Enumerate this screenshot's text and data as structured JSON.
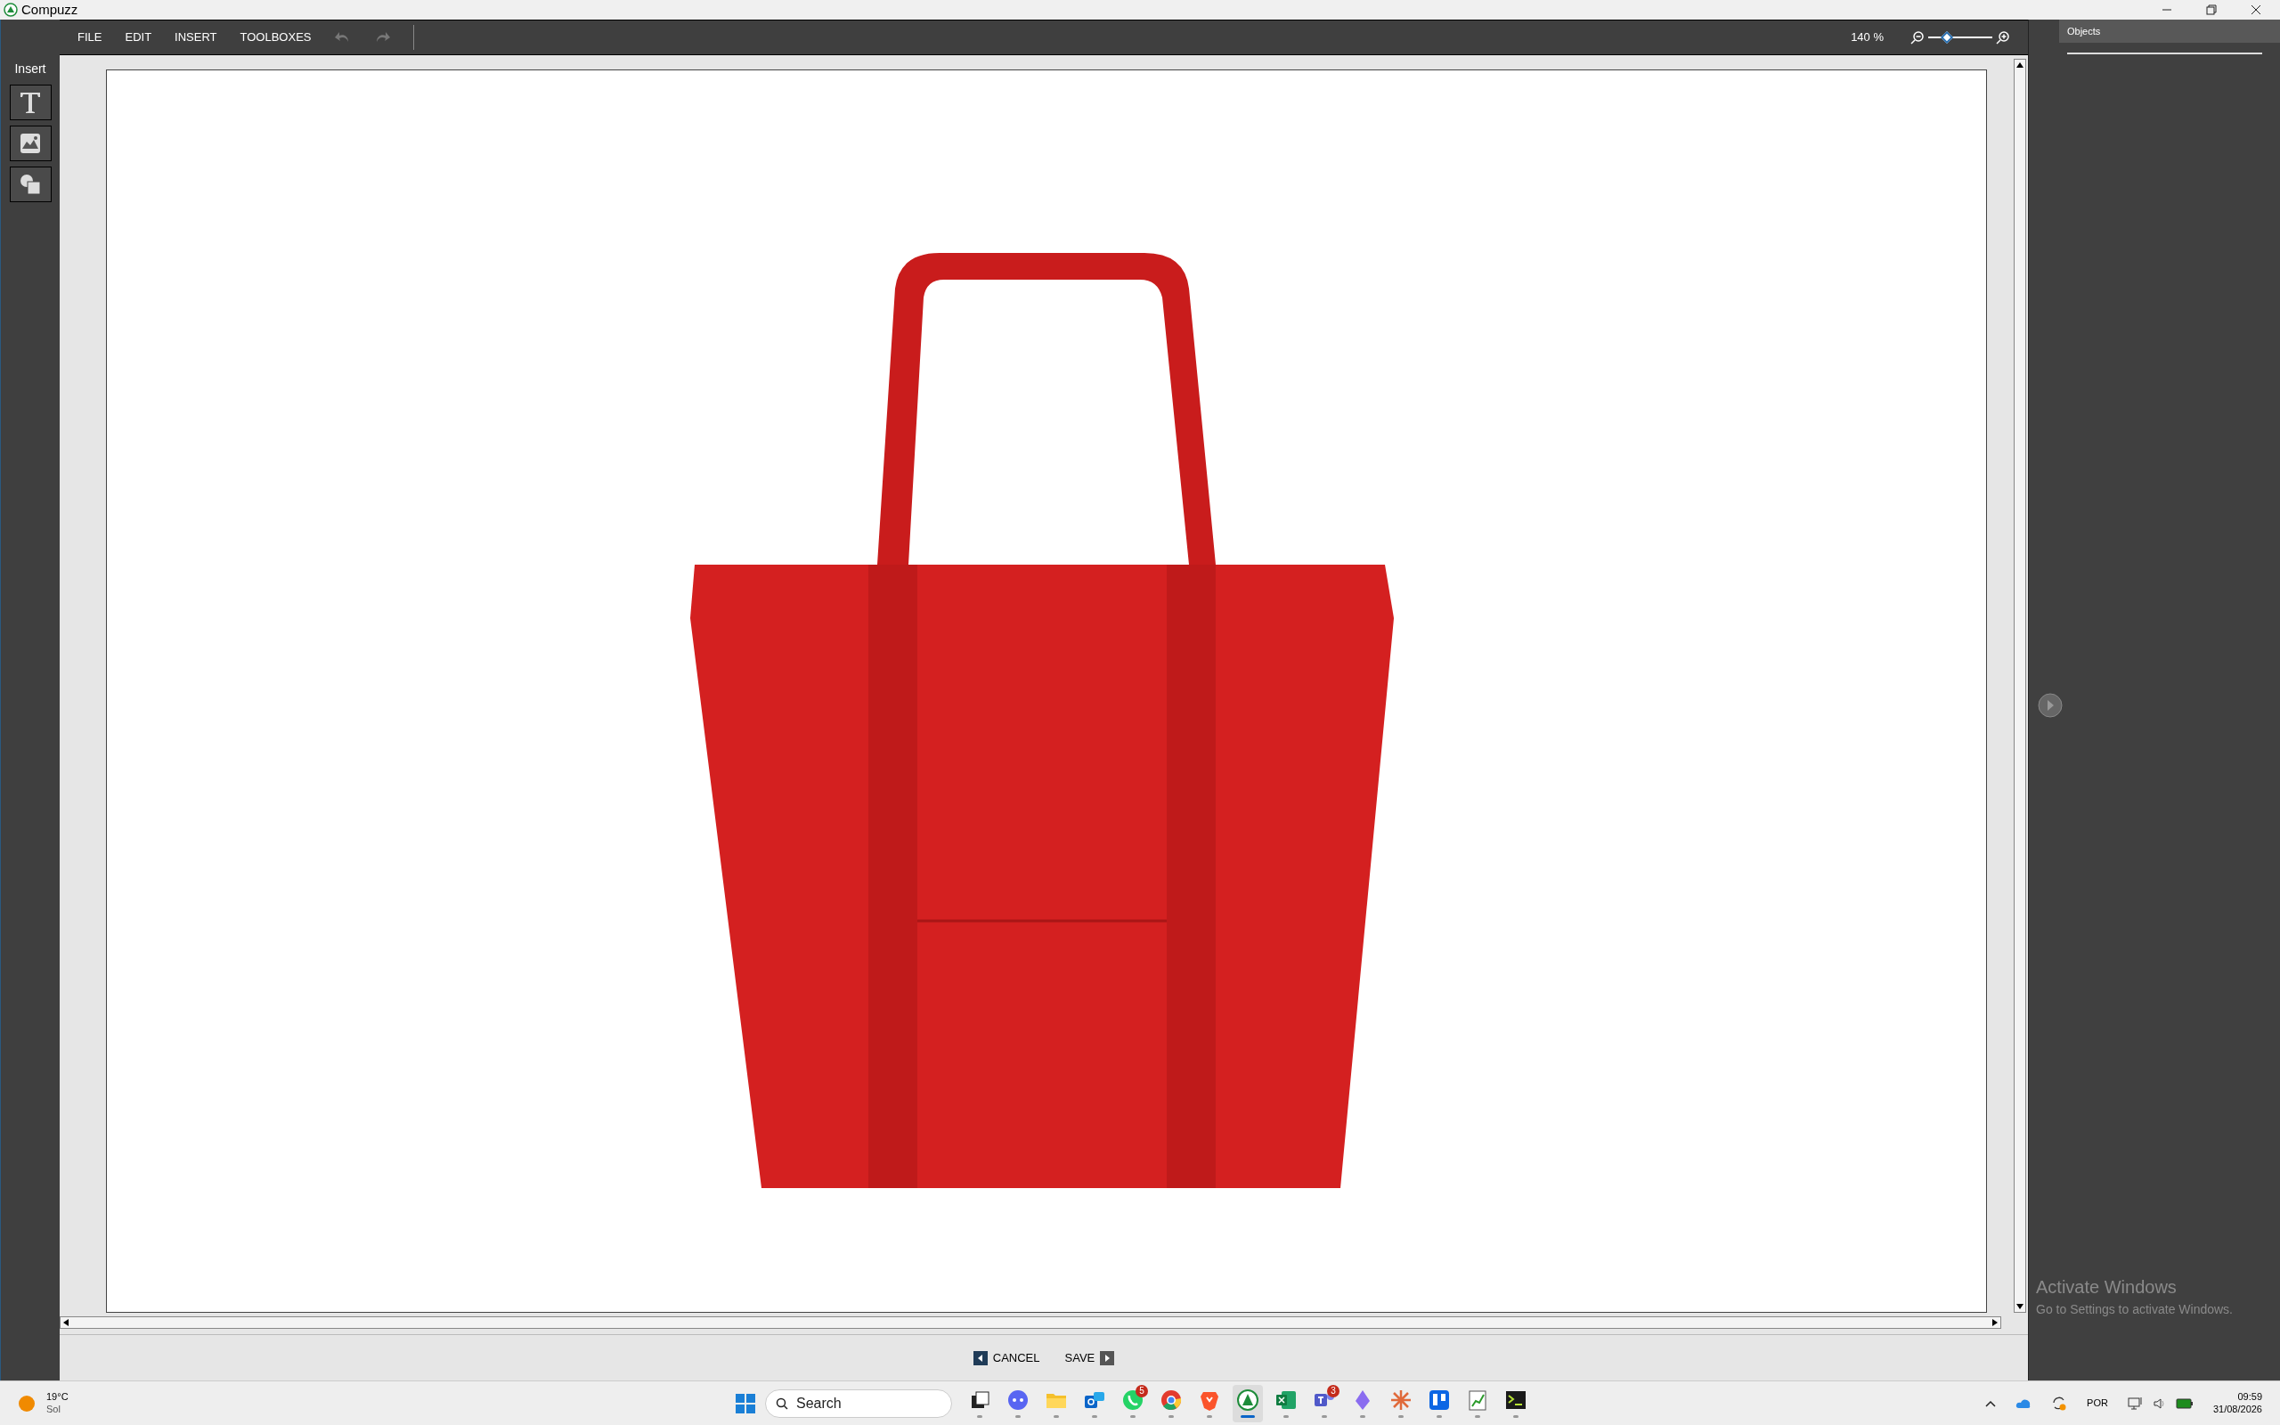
{
  "window": {
    "title": "Compuzz"
  },
  "menu": [
    "FILE",
    "EDIT",
    "INSERT",
    "TOOLBOXES"
  ],
  "zoom": {
    "reading": "140 %",
    "level": 0.26
  },
  "insert_panel": {
    "title": "Insert",
    "tools": [
      {
        "kind": "text"
      },
      {
        "kind": "image"
      },
      {
        "kind": "shape"
      }
    ]
  },
  "objects_panel": {
    "title": "Objects"
  },
  "buttons": [
    {
      "label": "CANCEL",
      "kind": "back"
    },
    {
      "label": "SAVE",
      "kind": "forward"
    }
  ],
  "system_overlay": {
    "title": "Activate Windows",
    "subtitle": "Go to Settings to activate Windows."
  },
  "taskbar": {
    "weather": {
      "temperature": "19°C",
      "condition": "Sol"
    },
    "search": {
      "placeholder": "Search"
    },
    "apps": [
      {
        "kind": "taskview",
        "active": false
      },
      {
        "kind": "chat",
        "active": false
      },
      {
        "kind": "folder",
        "active": false
      },
      {
        "kind": "mail",
        "active": false
      },
      {
        "kind": "whatsapp",
        "active": false,
        "badge": "5"
      },
      {
        "kind": "chrome",
        "active": false
      },
      {
        "kind": "brave",
        "active": false
      },
      {
        "kind": "compuzz",
        "active": true
      },
      {
        "kind": "excel",
        "active": false
      },
      {
        "kind": "teams",
        "active": false,
        "badge": "3"
      },
      {
        "kind": "crystal",
        "active": false
      },
      {
        "kind": "spark",
        "active": false
      },
      {
        "kind": "trello",
        "active": false
      },
      {
        "kind": "notepad",
        "active": false
      },
      {
        "kind": "terminal",
        "active": false
      }
    ],
    "language": "POR",
    "time": "09:59",
    "date": "31/08/2026"
  }
}
